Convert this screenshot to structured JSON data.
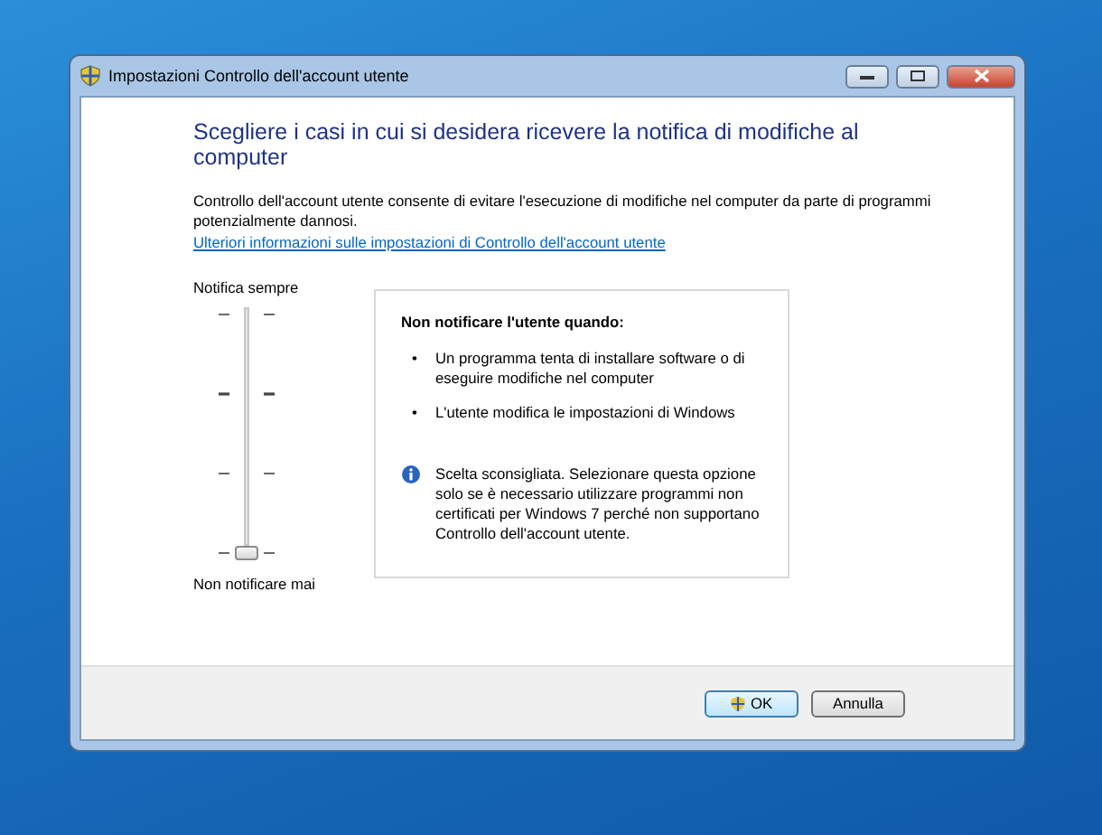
{
  "window": {
    "title": "Impostazioni Controllo dell'account utente"
  },
  "heading": "Scegliere i casi in cui si desidera ricevere la notifica di modifiche al computer",
  "description": "Controllo dell'account utente consente di evitare l'esecuzione di modifiche nel computer da parte di programmi potenzialmente dannosi.",
  "link": "Ulteriori informazioni sulle impostazioni di Controllo dell'account utente",
  "slider": {
    "top_label": "Notifica sempre",
    "bottom_label": "Non notificare mai",
    "level": 0
  },
  "info_panel": {
    "title": "Non notificare l'utente quando:",
    "bullets": [
      {
        "marker": "•",
        "text": "Un programma tenta di installare software o di eseguire modifiche nel computer"
      },
      {
        "marker": "•",
        "text": "L'utente modifica le impostazioni di Windows"
      }
    ],
    "note": "Scelta sconsigliata. Selezionare questa opzione solo se è necessario utilizzare programmi non certificati per Windows 7 perché non supportano Controllo dell'account utente."
  },
  "buttons": [
    {
      "label": "OK",
      "kind": "shield"
    },
    {
      "label": "Annulla",
      "kind": "plain"
    }
  ]
}
